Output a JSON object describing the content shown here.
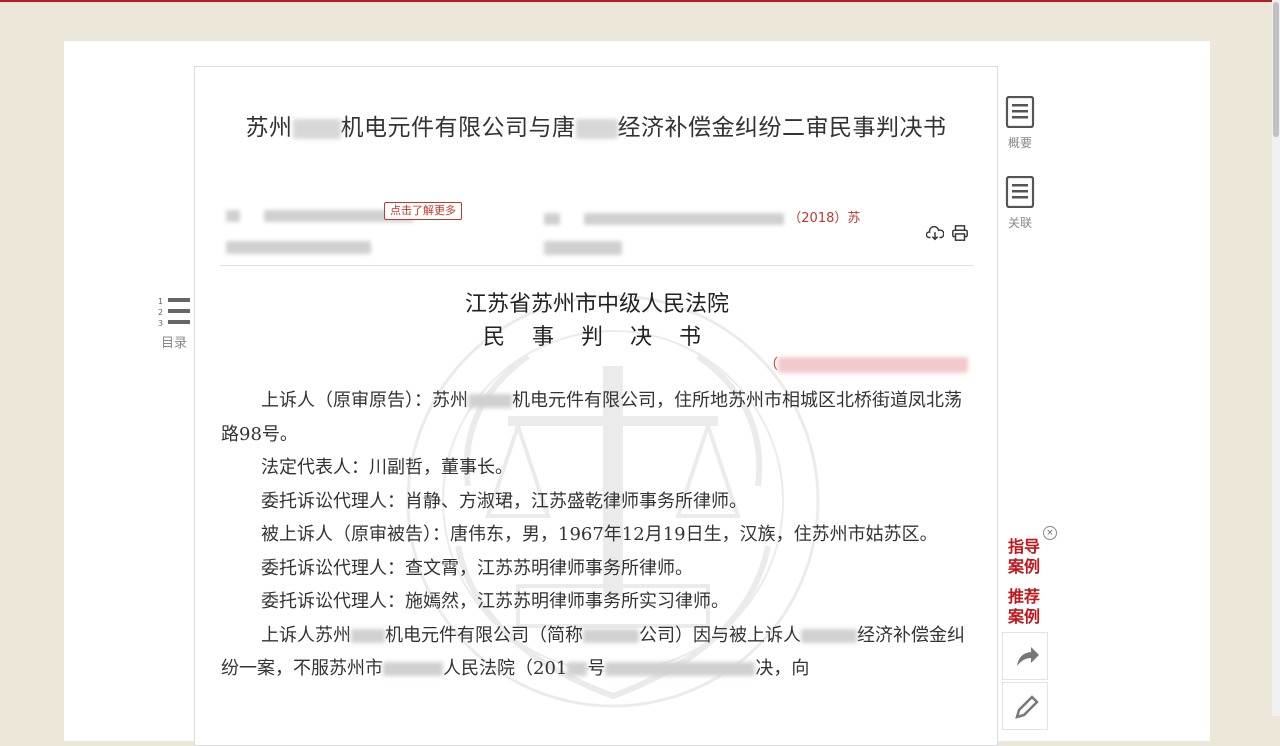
{
  "doc": {
    "title_parts": [
      "苏州",
      "机电元件有限公司与唐",
      "经济补偿金纠纷二审民事判决书"
    ],
    "learn_more": "点击了解更多",
    "case_no_suffix": "（2018）苏",
    "court": "江苏省苏州市中级人民法院",
    "doc_type": "民 事 判 决 书",
    "case_no_line": "（",
    "paragraphs": [
      [
        "上诉人（原审原告）：苏州",
        "机电元件有限公司，住所地苏州市相城区北桥街道凤北荡路98号。"
      ],
      [
        "法定代表人：川副哲，董事长。"
      ],
      [
        "委托诉讼代理人：肖静、方淑珺，江苏盛乾律师事务所律师。"
      ],
      [
        "被上诉人（原审被告）：唐伟东，男，1967年12月19日生，汉族，住苏州市姑苏区。"
      ],
      [
        "委托诉讼代理人：查文霄，江苏苏明律师事务所律师。"
      ],
      [
        "委托诉讼代理人：施嫣然，江苏苏明律师事务所实习律师。"
      ],
      [
        "上诉人苏州",
        "机电元件有限公司（简称",
        "公司）因与被上诉人",
        "经济补偿金纠纷一案，不服苏州市",
        "人民法院（201",
        "号",
        "决，向"
      ]
    ]
  },
  "toolbar": {
    "summary_label": "概要",
    "related_label": "关联",
    "toc_label": "目录",
    "toc_numbers": [
      "1",
      "2",
      "3"
    ],
    "guide_case": [
      "指导",
      "案例"
    ],
    "recommend_case": [
      "推荐",
      "案例"
    ],
    "close_symbol": "×"
  },
  "icons": {
    "download": "download-icon",
    "print": "print-icon",
    "summary": "document-icon",
    "related": "document-icon",
    "toc": "list-icon",
    "share": "share-icon",
    "edit": "pencil-icon"
  },
  "colors": {
    "accent": "#c0171d",
    "page_bg": "#ede7d9",
    "link_red": "#c0392b"
  }
}
